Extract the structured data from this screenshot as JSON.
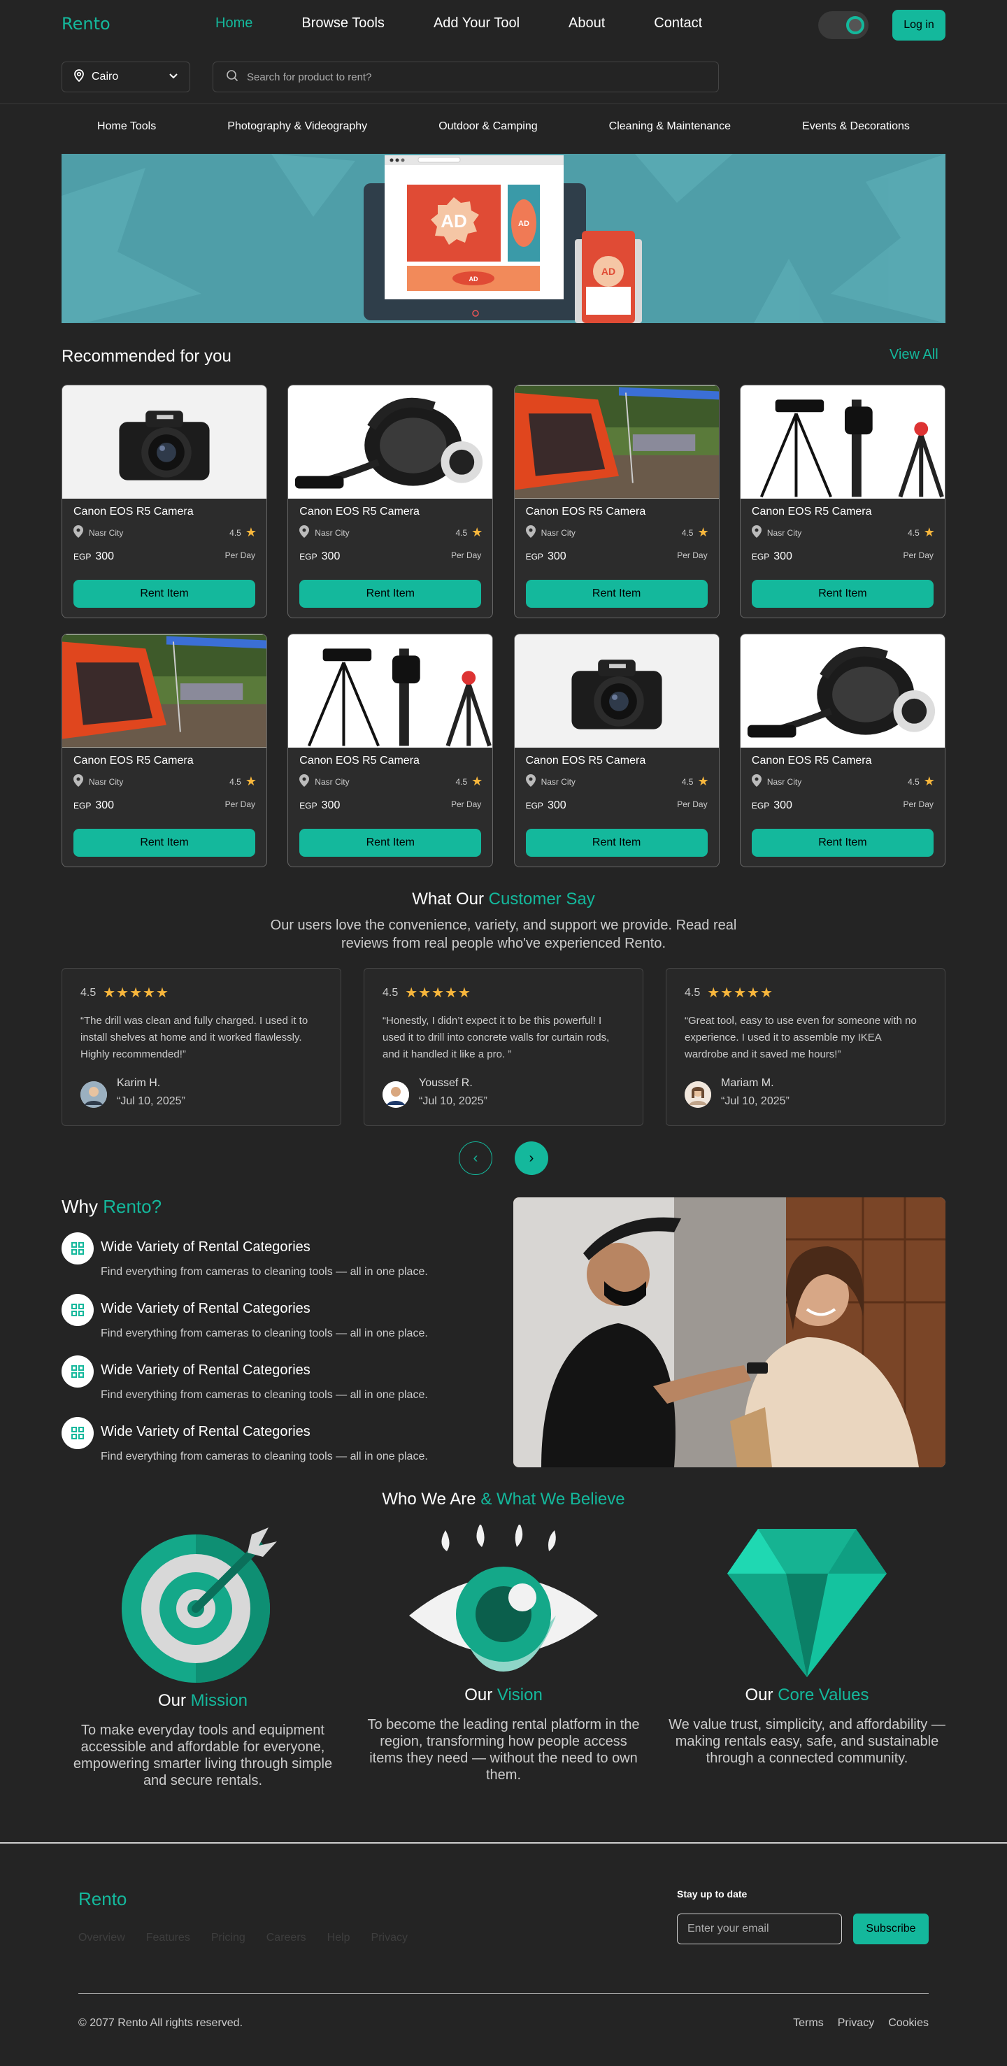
{
  "colors": {
    "accent": "#14b89c",
    "background": "#242424",
    "star": "#f7b63c"
  },
  "nav": {
    "logo": "Rento",
    "links": [
      "Home",
      "Browse Tools",
      "Add Your Tool",
      "About",
      "Contact"
    ],
    "active": "Home",
    "login": "Log in"
  },
  "location": {
    "value": "Cairo"
  },
  "search": {
    "placeholder": "Search for product to rent?"
  },
  "categories": [
    "Home Tools",
    "Photography & Videography",
    "Outdoor & Camping",
    "Cleaning & Maintenance",
    "Events & Decorations"
  ],
  "banner": {
    "ad_main": "AD",
    "ad_side": "AD",
    "ad_bottom": "AD",
    "ad_phone": "AD"
  },
  "recommended": {
    "title": "Recommended for you",
    "view_all": "View All",
    "rent_label": "Rent Item",
    "per_day": "Per Day",
    "currency": "EGP",
    "items": [
      {
        "name": "Canon EOS R5 Camera",
        "city": "Nasr City",
        "rating": "4.5",
        "price": "300",
        "image": "camera"
      },
      {
        "name": "Canon EOS R5 Camera",
        "city": "Nasr City",
        "rating": "4.5",
        "price": "300",
        "image": "vacuum"
      },
      {
        "name": "Canon EOS R5 Camera",
        "city": "Nasr City",
        "rating": "4.5",
        "price": "300",
        "image": "tent"
      },
      {
        "name": "Canon EOS R5 Camera",
        "city": "Nasr City",
        "rating": "4.5",
        "price": "300",
        "image": "tripod"
      },
      {
        "name": "Canon EOS R5 Camera",
        "city": "Nasr City",
        "rating": "4.5",
        "price": "300",
        "image": "tent"
      },
      {
        "name": "Canon EOS R5 Camera",
        "city": "Nasr City",
        "rating": "4.5",
        "price": "300",
        "image": "tripod"
      },
      {
        "name": "Canon EOS R5 Camera",
        "city": "Nasr City",
        "rating": "4.5",
        "price": "300",
        "image": "camera"
      },
      {
        "name": "Canon EOS R5 Camera",
        "city": "Nasr City",
        "rating": "4.5",
        "price": "300",
        "image": "vacuum"
      }
    ]
  },
  "testimonials": {
    "title_plain": "What Our ",
    "title_accent": "Customer Say",
    "subtitle": "Our users love the convenience, variety, and support we provide. Read real reviews from real people who've experienced Rento.",
    "items": [
      {
        "rating": "4.5",
        "quote": "“The drill was clean and fully charged. I used it to install shelves at home and it worked flawlessly. Highly recommended!”",
        "name": "Karim H.",
        "date": "“Jul 10, 2025”"
      },
      {
        "rating": "4.5",
        "quote": "“Honestly, I didn’t expect it to be this powerful! I used it to drill into concrete walls for curtain rods, and it handled it like a pro. ”",
        "name": "Youssef R.",
        "date": "“Jul 10, 2025”"
      },
      {
        "rating": "4.5",
        "quote": "“Great tool, easy to use even for someone with no experience. I used it to assemble my IKEA wardrobe and it saved me hours!”",
        "name": "Mariam M.",
        "date": "“Jul 10, 2025”"
      }
    ],
    "prev": "‹",
    "next": "›"
  },
  "why": {
    "title_plain": "Why ",
    "title_accent": "Rento?",
    "items": [
      {
        "title": "Wide Variety of Rental Categories",
        "text": "Find everything from cameras to cleaning tools — all in one place."
      },
      {
        "title": "Wide Variety of Rental Categories",
        "text": "Find everything from cameras to cleaning tools — all in one place."
      },
      {
        "title": "Wide Variety of Rental Categories",
        "text": "Find everything from cameras to cleaning tools — all in one place."
      },
      {
        "title": "Wide Variety of Rental Categories",
        "text": "Find everything from cameras to cleaning tools — all in one place."
      }
    ]
  },
  "about": {
    "title_plain": "Who We Are ",
    "title_accent": "& What We Believe",
    "mission": {
      "plain": "Our ",
      "accent": "Mission",
      "text": "To make everyday tools and equipment accessible and affordable for everyone, empowering smarter living through simple and secure rentals."
    },
    "vision": {
      "plain": "Our ",
      "accent": "Vision",
      "text": "To become the leading rental platform in the region, transforming how people access items they need — without the need to own them."
    },
    "values": {
      "plain": "Our ",
      "accent": "Core Values",
      "text": "We value trust, simplicity, and affordability — making rentals easy, safe, and sustainable through a connected community."
    }
  },
  "footer": {
    "logo": "Rento",
    "links": [
      "Overview",
      "Features",
      "Pricing",
      "Careers",
      "Help",
      "Privacy"
    ],
    "stay": "Stay up to date",
    "email_placeholder": "Enter your email",
    "subscribe": "Subscribe",
    "copyright": "© 2077 Rento All rights reserved.",
    "legal": [
      "Terms",
      "Privacy",
      "Cookies"
    ]
  }
}
